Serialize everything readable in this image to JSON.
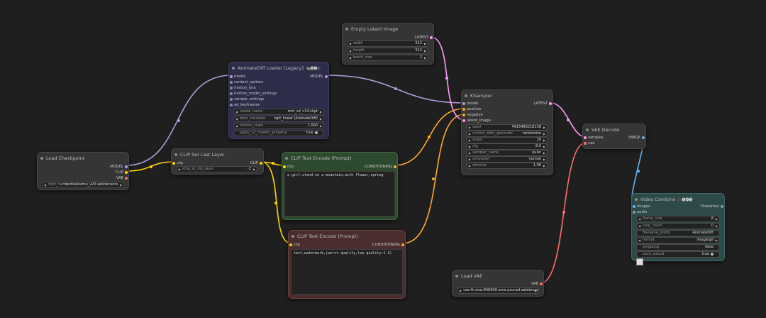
{
  "colors": {
    "background": "#1f1f1f",
    "model_wire": "#b39ddb",
    "clip_wire": "#ffd500",
    "conditioning_wire": "#ffa931",
    "latent_wire": "#ff9cf9",
    "vae_wire": "#ff6e6e",
    "image_wire": "#64b5f6",
    "green_node": "#2e4a2e",
    "red_node": "#4a2e2e",
    "blue_node": "#2d2d4a",
    "teal_node": "#2e4a48"
  },
  "nodes": {
    "load_checkpoint": {
      "title": "Load Checkpoint",
      "outputs": [
        "MODEL",
        "CLIP",
        "VAE"
      ],
      "ckpt_name_label": "ckpt_name",
      "ckpt_name_value": "cardosAnime_v20.safetensors"
    },
    "clip_set_last_layer": {
      "title": "CLIP Set Last Layer",
      "input": "clip",
      "output": "CLIP",
      "stop_label": "stop_at_clip_layer",
      "stop_value": "-2"
    },
    "animatediff": {
      "title": "AnimateDiff Loader [Legacy]",
      "badge": "🎭🅐🅓①",
      "inputs": [
        "model",
        "context_options",
        "motion_lora",
        "motion_model_settings",
        "sample_settings",
        "ad_keyframes"
      ],
      "output": "MODEL",
      "widgets": [
        {
          "label": "model_name",
          "value": "mm_sd_v14.ckpt"
        },
        {
          "label": "beta_schedule",
          "value": "sqrt_linear (AnimateDiff)"
        },
        {
          "label": "motion_scale",
          "value": "1.000"
        }
      ],
      "toggle_label": "apply_v2_models_properly",
      "toggle_value": "true"
    },
    "empty_latent": {
      "title": "Empty Latent Image",
      "output": "LATENT",
      "widgets": [
        {
          "label": "width",
          "value": "512"
        },
        {
          "label": "height",
          "value": "512"
        },
        {
          "label": "batch_size",
          "value": "2"
        }
      ]
    },
    "clip_text_pos": {
      "title": "CLIP Text Encode (Prompt)",
      "input": "clip",
      "output": "CONDITIONING",
      "text": "a girl,stand on a mountain,with flower,spring"
    },
    "clip_text_neg": {
      "title": "CLIP Text Encode (Prompt)",
      "input": "clip",
      "output": "CONDITIONING",
      "text": "text,watermark,(worst quality,low quality:1.4)"
    },
    "ksampler": {
      "title": "KSampler",
      "inputs": [
        "model",
        "positive",
        "negative",
        "latent_image"
      ],
      "output": "LATENT",
      "widgets": [
        {
          "label": "seed",
          "value": "491546621813​8"
        },
        {
          "label": "control_after_generate",
          "value": "randomize"
        },
        {
          "label": "steps",
          "value": "20"
        },
        {
          "label": "cfg",
          "value": "8.0"
        },
        {
          "label": "sampler_name",
          "value": "euler"
        },
        {
          "label": "scheduler",
          "value": "normal"
        },
        {
          "label": "denoise",
          "value": "1.00"
        }
      ]
    },
    "vae_decode": {
      "title": "VAE Decode",
      "inputs": [
        "samples",
        "vae"
      ],
      "output": "IMAGE"
    },
    "video_combine": {
      "title": "Video Combine",
      "badge": "🎥🅥🅗🅢",
      "inputs": [
        "images",
        "audio"
      ],
      "output": "Filenames",
      "widgets": [
        {
          "label": "frame_rate",
          "value": "8"
        },
        {
          "label": "loop_count",
          "value": "0"
        },
        {
          "label": "filename_prefix",
          "value": "AnimateDiff"
        },
        {
          "label": "format",
          "value": "image/gif"
        },
        {
          "label": "pingpong",
          "value": "false"
        },
        {
          "label": "save_output",
          "value": "true"
        }
      ]
    },
    "load_vae": {
      "title": "Load VAE",
      "output": "VAE",
      "vae_name_value": "vae-ft-mse-840000-ema-pruned.safetensors"
    }
  }
}
